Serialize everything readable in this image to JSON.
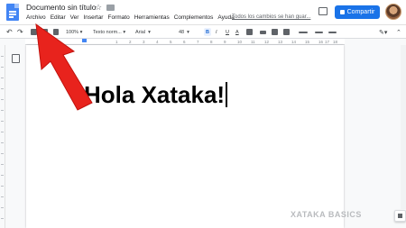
{
  "header": {
    "doc_title": "Documento sin título",
    "menu": [
      "Archivo",
      "Editar",
      "Ver",
      "Insertar",
      "Formato",
      "Herramientas",
      "Complementos",
      "Ayuda"
    ],
    "save_status": "Todos los cambios se han guar...",
    "share_label": "Compartir"
  },
  "toolbar": {
    "zoom": "100%",
    "style": "Texto norm...",
    "font": "Arial",
    "size": "48",
    "bold": "B",
    "italic": "I",
    "underline": "U",
    "text_color": "A"
  },
  "ruler": {
    "marks": [
      "1",
      "2",
      "3",
      "4",
      "5",
      "6",
      "7",
      "8",
      "9",
      "10",
      "11",
      "12",
      "13",
      "14",
      "15",
      "16",
      "17",
      "18"
    ]
  },
  "document": {
    "text": "Hola Xataka!"
  },
  "watermark": "XATAKA BASICS",
  "colors": {
    "accent": "#1a73e8",
    "arrow": "#e8231d"
  }
}
